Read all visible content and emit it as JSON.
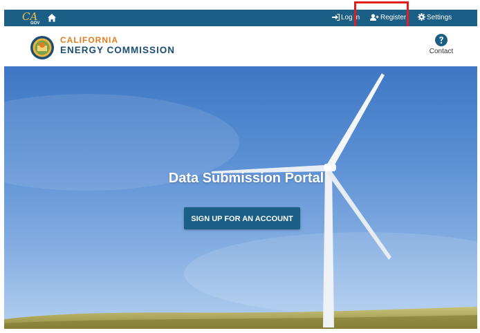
{
  "utility_bar": {
    "gov_logo": "CA",
    "gov_text": "GOV",
    "login_label": "Log in",
    "register_label": "Register",
    "settings_label": "Settings"
  },
  "header": {
    "brand_line1": "CALIFORNIA",
    "brand_line2": "ENERGY COMMISSION",
    "contact_label": "Contact"
  },
  "hero": {
    "title": "Data Submission Portal",
    "cta_label": "SIGN UP FOR AN ACCOUNT"
  },
  "colors": {
    "primary": "#1c5f86",
    "accent": "#e07d1f",
    "highlight": "#e41e1e"
  },
  "icons": [
    "home-icon",
    "sign-in-icon",
    "user-plus-icon",
    "gear-icon",
    "question-icon",
    "seal-icon"
  ]
}
